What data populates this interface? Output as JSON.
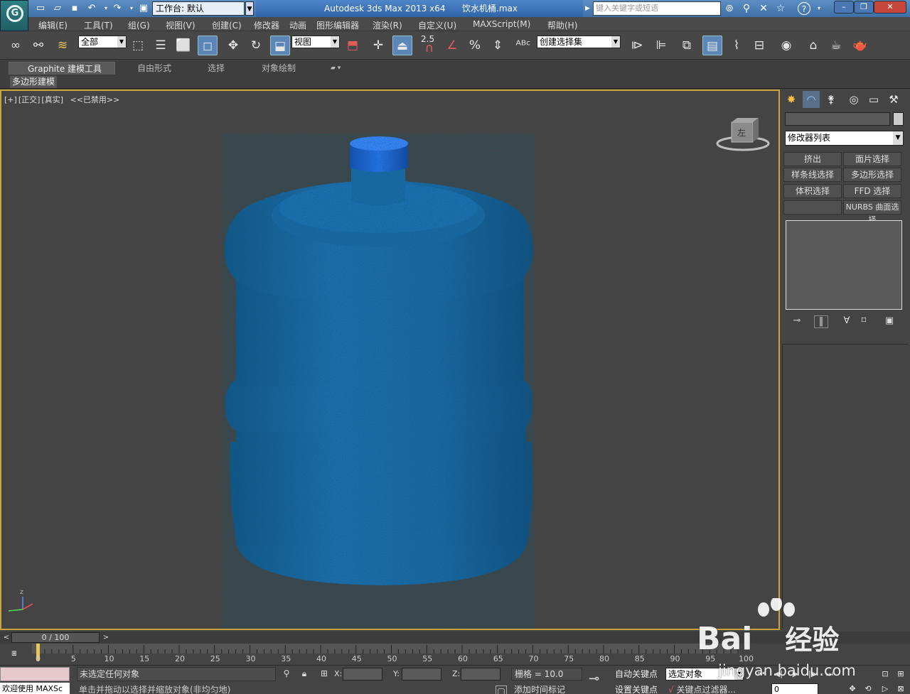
{
  "titlebar": {
    "workspace": "工作台: 默认",
    "app_title": "Autodesk 3ds Max  2013 x64",
    "file_name": "饮水机桶.max",
    "search_placeholder": "键入关键字或短语",
    "help": "?"
  },
  "menu": [
    "编辑(E)",
    "工具(T)",
    "组(G)",
    "视图(V)",
    "创建(C)",
    "修改器",
    "动画",
    "图形编辑器",
    "渲染(R)",
    "自定义(U)",
    "MAXScript(M)",
    "帮助(H)"
  ],
  "toolbar": {
    "filter": "全部",
    "ref_coord": "视图",
    "snap_value": "2.5",
    "named_selection": "创建选择集"
  },
  "ribbon": {
    "tabs": [
      "Graphite 建模工具",
      "自由形式",
      "选择",
      "对象绘制"
    ],
    "panel": "多边形建模"
  },
  "viewport": {
    "label_plus": "[+]",
    "label_view": "[正交]",
    "label_shading": "[真实]",
    "label_disabled": "<<已禁用>>",
    "cube_label": "左"
  },
  "command_panel": {
    "modifier_list": "修改器列表",
    "buttons": [
      "挤出",
      "面片选择",
      "样条线选择",
      "多边形选择",
      "体积选择",
      "FFD 选择",
      "",
      "NURBS 曲面选择"
    ]
  },
  "timeline": {
    "slider": "0 / 100",
    "ticks": [
      "0",
      "5",
      "10",
      "15",
      "20",
      "25",
      "30",
      "35",
      "40",
      "45",
      "50",
      "55",
      "60",
      "65",
      "70",
      "75",
      "80",
      "85",
      "90",
      "95",
      "100"
    ]
  },
  "status": {
    "maxscript_welcome": "欢迎使用 MAXSc",
    "selection": "未选定任何对象",
    "prompt": "单击并拖动以选择并缩放对象(非均匀地)",
    "x_label": "X:",
    "y_label": "Y:",
    "z_label": "Z:",
    "grid": "栅格 = 10.0",
    "add_time_tag": "添加时间标记",
    "auto_key": "自动关键点",
    "set_key": "设置关键点",
    "selected": "选定对象",
    "key_filter": "关键点过滤器...",
    "frame": "0"
  },
  "watermark": {
    "brand": "Bai",
    "brand2": "经验",
    "url": "jingyan.baidu.com"
  },
  "colors": {
    "bottle": "#1f6fae",
    "cap": "#1e5ed6",
    "viewport_border": "#c9a43a"
  }
}
